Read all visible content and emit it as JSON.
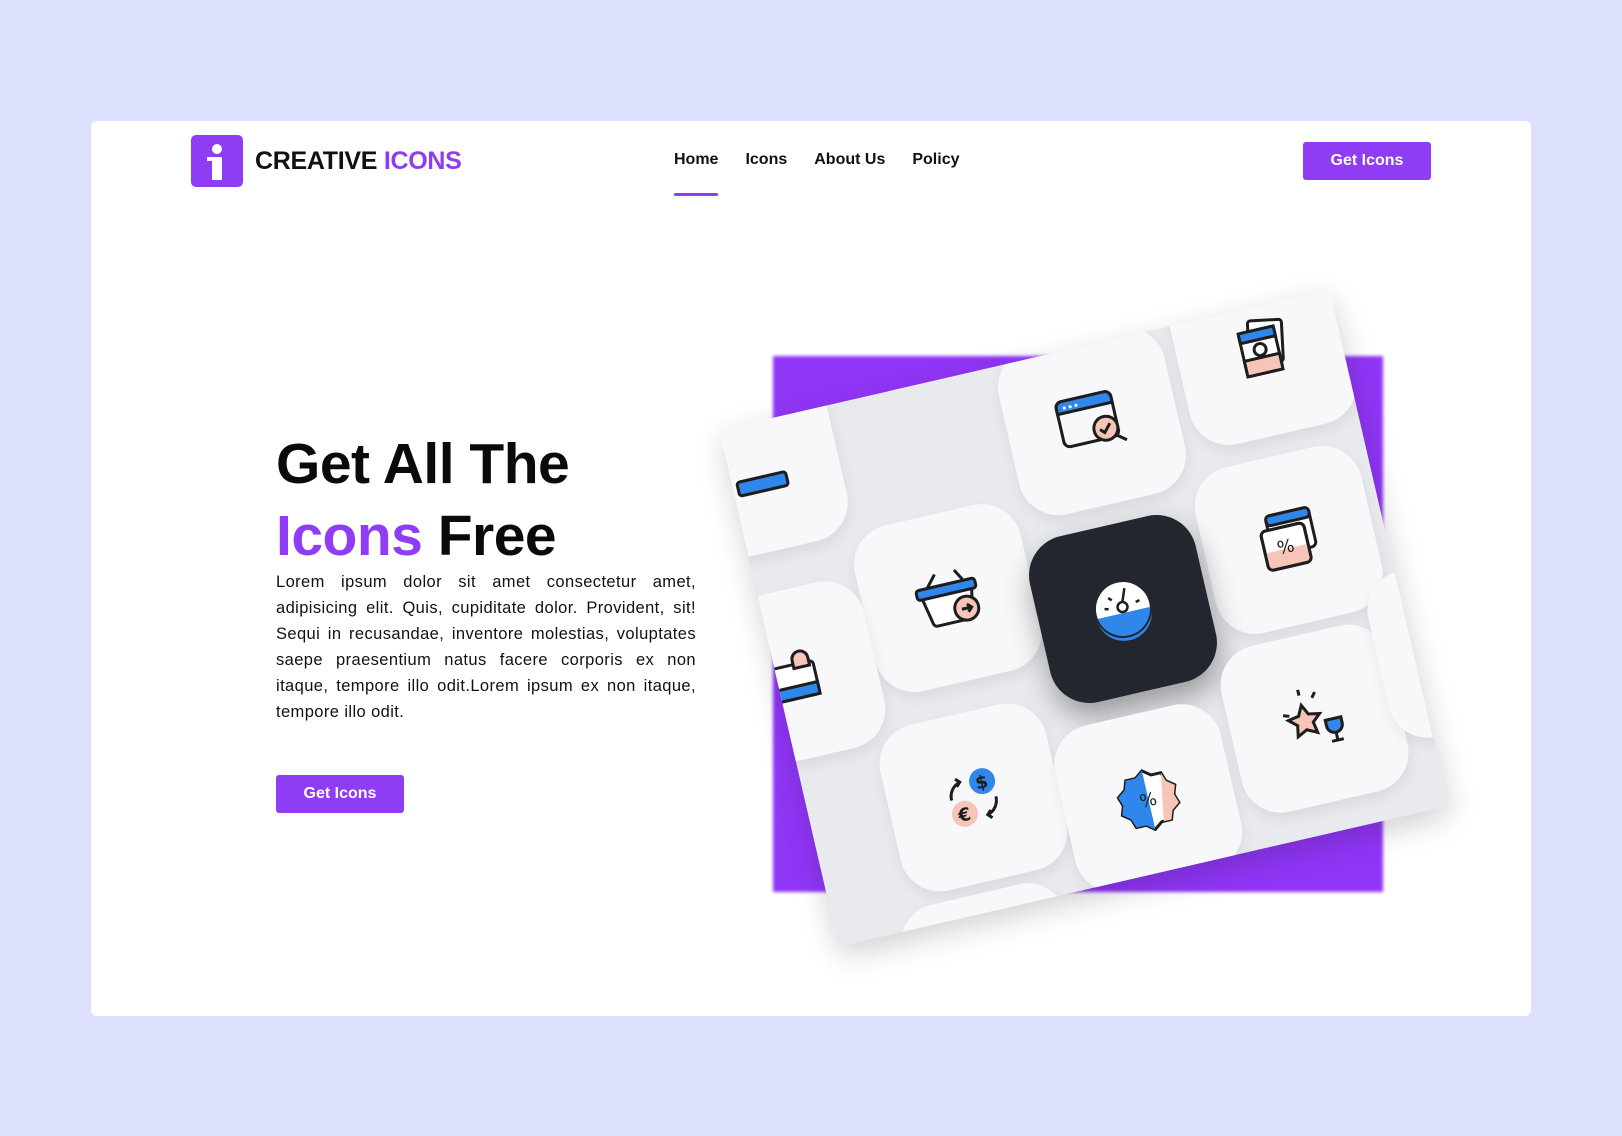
{
  "brand": {
    "name_part1": "CREATIVE",
    "name_part2": "ICONS",
    "logo_icon": "info-letter-icon"
  },
  "nav": {
    "items": [
      {
        "label": "Home",
        "active": true
      },
      {
        "label": "Icons",
        "active": false
      },
      {
        "label": "About Us",
        "active": false
      },
      {
        "label": "Policy",
        "active": false
      }
    ]
  },
  "header": {
    "cta_label": "Get Icons"
  },
  "hero": {
    "title_line1": "Get All The",
    "title_accent": "Icons",
    "title_rest": " Free",
    "body": "Lorem ipsum dolor sit amet consectetur amet, adipisicing elit. Quis, cupiditate dolor. Provident, sit! Sequi in recusandae, inventore molestias, voluptates saepe praesentium natus facere corporis ex non itaque, tempore illo odit.Lorem ipsum  ex non itaque, tempore illo odit.",
    "cta_label": "Get Icons"
  },
  "illustration": {
    "tiles": [
      "browser-icon",
      "documents-icon",
      "shopping-basket-icon",
      "discount-window-icon",
      "speedometer-icon",
      "currency-exchange-icon",
      "star-trophy-icon",
      "discount-badge-icon",
      "notification-icon",
      "chat-icon"
    ]
  },
  "colors": {
    "accent": "#8f3cf5",
    "background": "#dee1fe",
    "blue": "#2f86eb",
    "peach": "#f7c4b8",
    "dark_tile": "#23262e"
  }
}
